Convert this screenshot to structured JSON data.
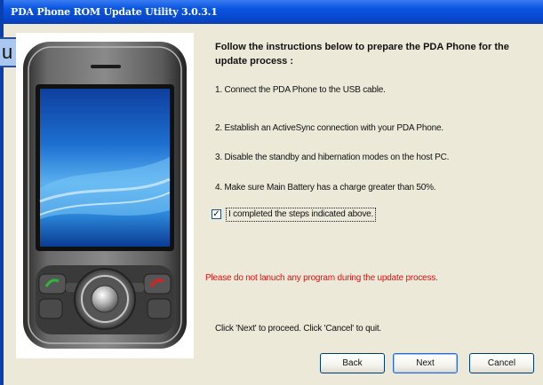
{
  "window": {
    "title": "PDA Phone ROM Update Utility 3.0.3.1"
  },
  "background_app": {
    "fragment": "u"
  },
  "instructions": {
    "heading": "Follow the instructions below to prepare the PDA Phone for the update process :",
    "steps": [
      "1. Connect the PDA Phone to the USB cable.",
      "2. Establish an ActiveSync connection with your PDA Phone.",
      "3. Disable the standby and hibernation modes on the host PC.",
      "4. Make sure Main Battery has a charge greater than 50%."
    ]
  },
  "confirm": {
    "checked": true,
    "check_mark": "✓",
    "label": "I completed the steps indicated above."
  },
  "warning": {
    "text": "Please do not lanuch any program during the update process.",
    "color": "#e01010"
  },
  "hint": {
    "text": "Click 'Next' to proceed. Click 'Cancel' to quit."
  },
  "buttons": {
    "back": "Back",
    "next": "Next",
    "cancel": "Cancel"
  },
  "colors": {
    "titlebar": "#0a56e2",
    "dialog_bg": "#ece9d8",
    "screen_blue": "#1d6fd0"
  }
}
